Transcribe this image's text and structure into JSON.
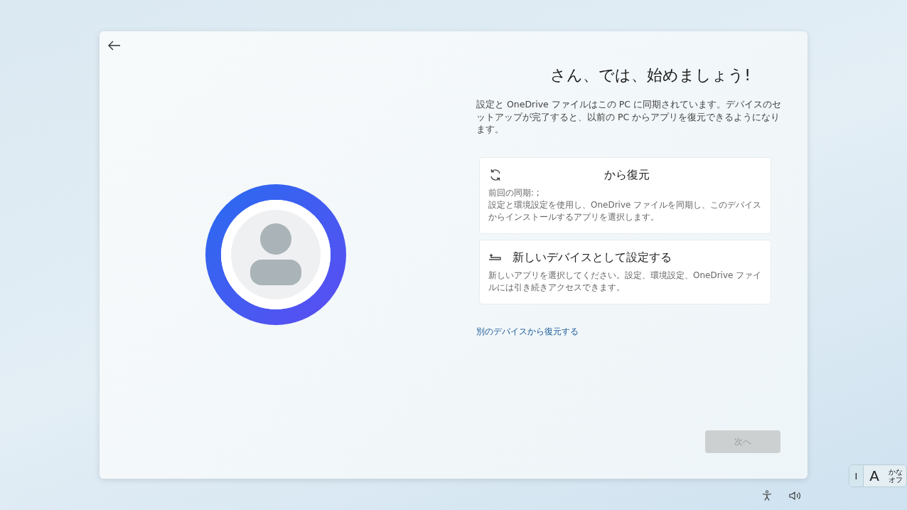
{
  "title": "さん、では、始めましょう!",
  "description": "設定と OneDrive ファイルはこの PC に同期されています。デバイスのセットアップが完了すると、以前の PC からアプリを復元できるようになります。",
  "options": [
    {
      "kind": "restore",
      "title": "から復元",
      "lines": [
        "前回の同期: ;",
        "設定と環境設定を使用し、OneDrive ファイルを同期し、このデバイスからインストールするアプリを選択します。"
      ]
    },
    {
      "kind": "new",
      "title": "新しいデバイスとして設定する",
      "lines": [
        "新しいアプリを選択してください。設定、環境設定、OneDrive ファイルには引き続きアクセスできます。"
      ]
    }
  ],
  "link": "別のデバイスから復元する",
  "next_button": {
    "label": "次へ",
    "disabled": true
  },
  "ime": {
    "cursor": "I",
    "mode": "A",
    "kana_lines": [
      "かな",
      "オフ"
    ]
  }
}
